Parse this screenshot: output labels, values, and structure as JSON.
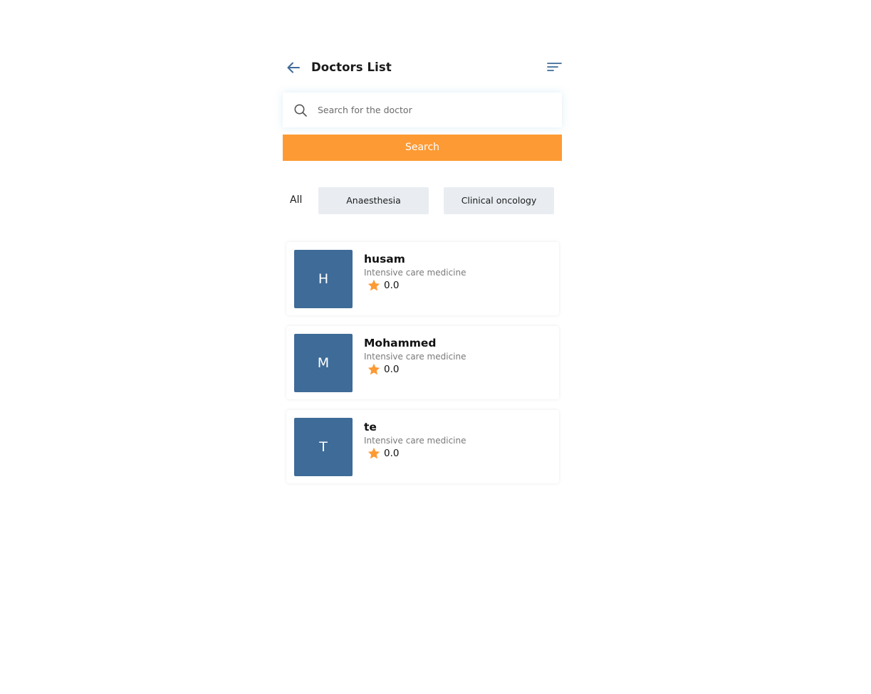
{
  "header": {
    "title": "Doctors List",
    "back_icon": "arrow-left-icon",
    "filter_icon": "sort-lines-icon"
  },
  "search": {
    "placeholder": "Search for the doctor",
    "value": "",
    "button_label": "Search"
  },
  "tabs": {
    "all_label": "All",
    "chips": [
      "Anaesthesia",
      "Clinical oncology"
    ]
  },
  "doctors": [
    {
      "initial": "H",
      "name": "husam",
      "specialty": "Intensive care medicine",
      "rating": "0.0"
    },
    {
      "initial": "M",
      "name": "Mohammed",
      "specialty": "Intensive care medicine",
      "rating": "0.0"
    },
    {
      "initial": "T",
      "name": "te",
      "specialty": "Intensive care medicine",
      "rating": "0.0"
    }
  ],
  "colors": {
    "accent": "#fd9a33",
    "avatar_bg": "#3e6b98",
    "icon_blue": "#3e6b98",
    "chip_bg": "#e9edf2"
  }
}
